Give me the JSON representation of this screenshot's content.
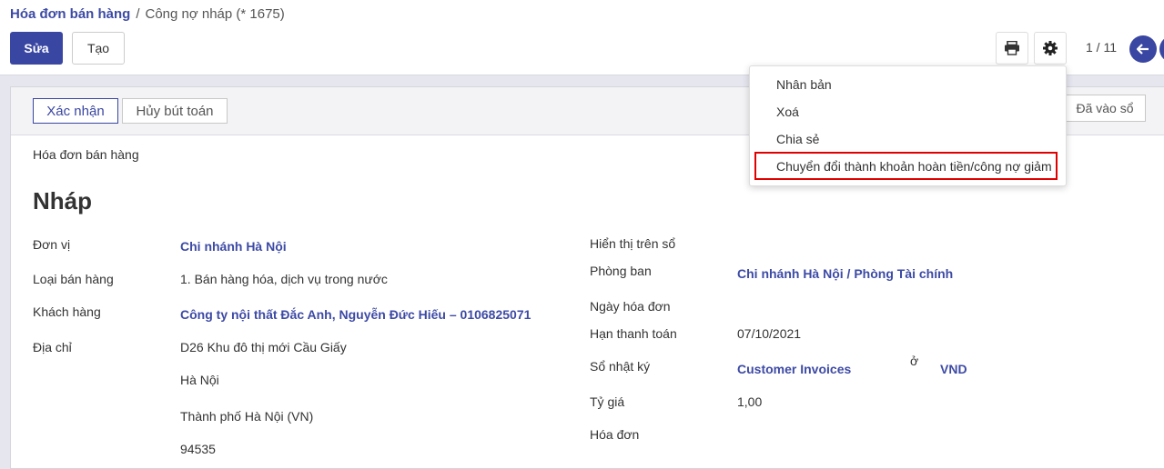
{
  "breadcrumb": {
    "parent": "Hóa đơn bán hàng",
    "separator": "/",
    "current": "Công nợ nháp (* 1675)"
  },
  "toolbar": {
    "edit_label": "Sửa",
    "create_label": "Tạo",
    "print_icon": "print-icon",
    "settings_icon": "gear-icon",
    "pager": "1 / 11"
  },
  "statusbar": {
    "confirm_label": "Xác nhận",
    "cancel_entry_label": "Hủy bút toán",
    "posted_label": "Đã vào sổ"
  },
  "form": {
    "doc_type": "Hóa đơn bán hàng",
    "title": "Nháp",
    "left": {
      "unit_label": "Đơn vị",
      "unit_value": "Chi nhánh Hà Nội",
      "sale_type_label": "Loại bán hàng",
      "sale_type_value": "1. Bán hàng hóa, dịch vụ trong nước",
      "customer_label": "Khách hàng",
      "customer_value": "Công ty nội thất Đắc Anh, Nguyễn Đức Hiếu – 0106825071",
      "address_label": "Địa chỉ",
      "address_line1": "D26 Khu đô thị mới Cầu Giấy",
      "address_line2": "Hà Nội",
      "address_line3": "Thành phố Hà Nội (VN)",
      "address_line4": "94535"
    },
    "right": {
      "show_in_book_label": "Hiển thị trên sổ",
      "department_label": "Phòng ban",
      "department_value": "Chi nhánh Hà Nội / Phòng Tài chính",
      "invoice_date_label": "Ngày hóa đơn",
      "due_date_label": "Hạn thanh toán",
      "due_date_value": "07/10/2021",
      "journal_label": "Sổ nhật ký",
      "journal_value": "Customer Invoices",
      "in_label": "ở",
      "currency_value": "VND",
      "rate_label": "Tỷ giá",
      "rate_value": "1,00",
      "invoice_label": "Hóa đơn"
    }
  },
  "dropdown": {
    "items": [
      "Nhân bản",
      "Xoá",
      "Chia sẻ",
      "Chuyển đổi thành khoản hoàn tiền/công nợ giảm"
    ],
    "highlight_color": "#e00000"
  },
  "colors": {
    "primary": "#3946a2",
    "link": "#3d4aa5",
    "background": "#e6e6ef"
  }
}
